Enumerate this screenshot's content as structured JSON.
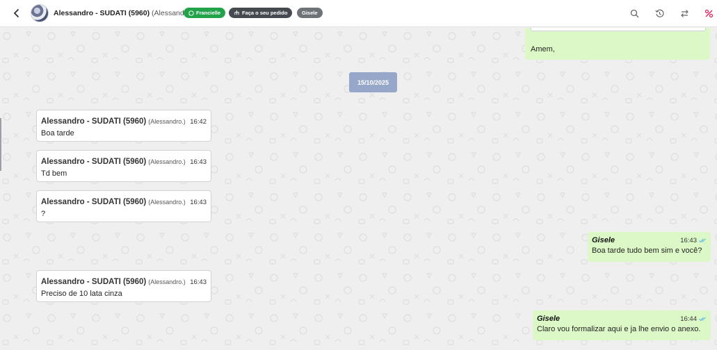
{
  "header": {
    "contact_name": "Alessandro - SUDATI (5960)",
    "contact_sub": "(Alessandro.)",
    "tags": [
      {
        "label": "Francielle",
        "color": "#22a34a"
      },
      {
        "label": "Faça o seu pedido",
        "color": "#444a4f"
      },
      {
        "label": "Gisele",
        "color": "#6e7378"
      }
    ],
    "icons": [
      "back-arrow-icon",
      "search-icon",
      "history-icon",
      "transfer-icon",
      "percent-icon"
    ]
  },
  "chat": {
    "previous_message": {
      "text": "Amem,"
    },
    "date_separator": "15/10/2025",
    "incoming": [
      {
        "author": "Alessandro - SUDATI (5960)",
        "author_sub": "(Alessandro.)",
        "time": "16:42",
        "text": "Boa tarde"
      },
      {
        "author": "Alessandro - SUDATI (5960)",
        "author_sub": "(Alessandro.)",
        "time": "16:43",
        "text": "Td bem"
      },
      {
        "author": "Alessandro - SUDATI (5960)",
        "author_sub": "(Alessandro.)",
        "time": "16:43",
        "text": "?"
      },
      {
        "author": "Alessandro - SUDATI (5960)",
        "author_sub": "(Alessandro.)",
        "time": "16:43",
        "text": "Preciso de 10 lata cinza"
      }
    ],
    "outgoing": [
      {
        "author": "Gisele",
        "time": "16:43",
        "text": "Boa tarde tudo bem sim e você?"
      },
      {
        "author": "Gisele",
        "time": "16:44",
        "text": "Claro vou formalizar aqui e ja lhe envio o anexo."
      }
    ]
  },
  "colors": {
    "outgoing_bubble": "#dcf8c6",
    "incoming_bubble": "#ffffff",
    "date_chip": "#97a7c9",
    "chat_background": "#efefef",
    "accent_red": "#e0245e",
    "read_check": "#4fb3e8"
  }
}
